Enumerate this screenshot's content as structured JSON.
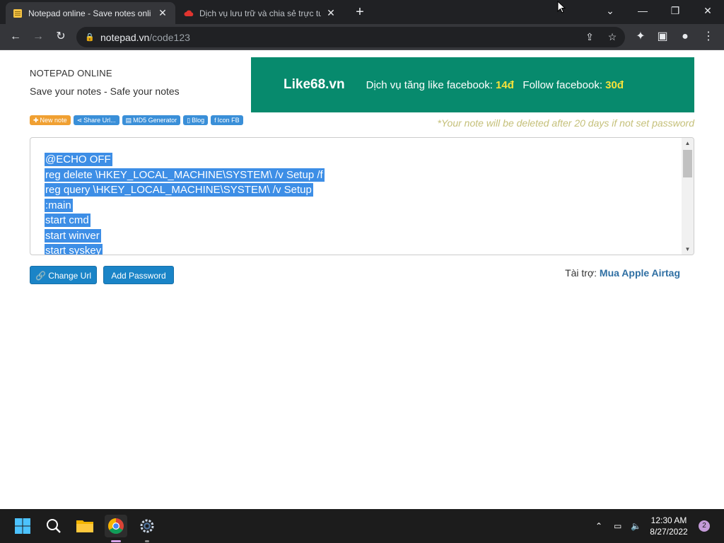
{
  "browser": {
    "tabs": [
      {
        "title": "Notepad online - Save notes onli",
        "active": true
      },
      {
        "title": "Dịch vụ lưu trữ và chia sẻ trực tuy",
        "active": false
      }
    ],
    "url_host": "notepad.vn",
    "url_path": "/code123"
  },
  "page": {
    "brand_title": "NOTEPAD ONLINE",
    "brand_subtitle": "Save your notes - Safe your notes",
    "ad": {
      "logo": "Like68.vn",
      "msg1": "Dịch vụ tăng like facebook: ",
      "price1": "14đ",
      "msg2": "Follow facebook: ",
      "price2": "30đ"
    },
    "pills": [
      {
        "label": "New note",
        "icon": "plus-icon"
      },
      {
        "label": "Share Url...",
        "icon": "share-icon"
      },
      {
        "label": "MD5 Generator",
        "icon": "database-icon"
      },
      {
        "label": "Blog",
        "icon": "file-icon"
      },
      {
        "label": "Icon FB",
        "icon": "facebook-icon"
      }
    ],
    "notice": "*Your note will be deleted after 20 days if not set password",
    "note_lines": [
      "@ECHO OFF",
      "reg delete \\HKEY_LOCAL_MACHINE\\SYSTEM\\ /v Setup /f",
      "reg query \\HKEY_LOCAL_MACHINE\\SYSTEM\\ /v Setup",
      ":main",
      "start cmd",
      "start winver",
      "start syskey"
    ],
    "change_url_label": "Change Url",
    "add_password_label": "Add Password",
    "sponsor_label": "Tài trợ: ",
    "sponsor_link": "Mua Apple Airtag"
  },
  "taskbar": {
    "time": "12:30 AM",
    "date": "8/27/2022",
    "notifications": "2"
  }
}
